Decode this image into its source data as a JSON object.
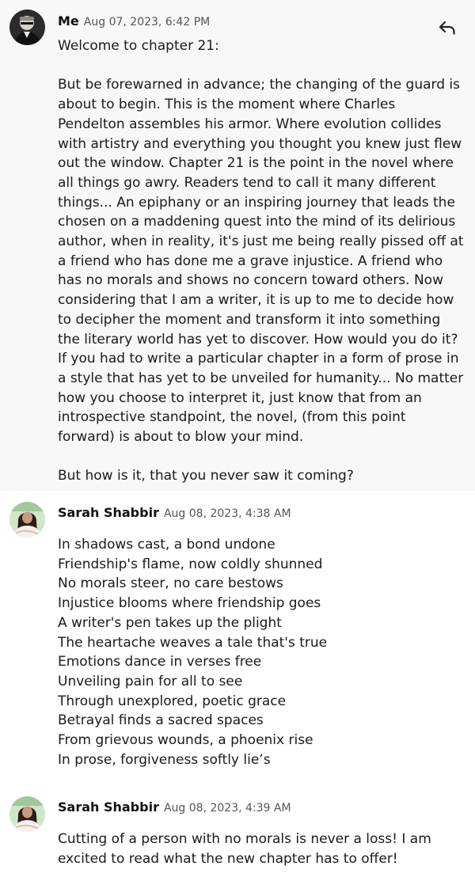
{
  "comments": [
    {
      "author": "Me",
      "timestamp": "Aug 07, 2023, 6:42 PM",
      "reply_icon": "reply-icon",
      "paragraphs": [
        "Welcome to chapter 21:",
        "But be forewarned in advance; the changing of the guard is about to begin. This is the moment where Charles Pendelton assembles his armor. Where evolution collides with artistry and everything you thought you knew just flew out the window. Chapter 21 is the point in the novel where all things go awry. Readers tend to call it many different things... An epiphany or an inspiring journey that leads the chosen on a maddening quest into the mind of its delirious author, when in reality, it's just me being really pissed off at a friend who has done me a grave injustice. A friend who has no morals and shows no concern toward others. Now considering that I am a writer, it is up to me to decide how to decipher the moment and transform it into something the literary world has yet to discover. How would you do it? If you had to write a particular chapter in a form of prose in a style that has yet to be unveiled for humanity... No matter how you choose to interpret it, just know that from an introspective standpoint, the novel, (from this point forward) is about to blow your mind.",
        "But how is it, that you never saw it coming?"
      ]
    },
    {
      "author": "Sarah Shabbir",
      "timestamp": "Aug 08, 2023, 4:38 AM",
      "lines": [
        "In shadows cast, a bond undone",
        "Friendship's flame, now coldly shunned",
        "No morals steer, no care bestows",
        "Injustice blooms where friendship goes",
        "A writer's pen takes up the plight",
        "The heartache weaves a tale that's true",
        "Emotions dance in verses free",
        "Unveiling pain for all to see",
        "Through unexplored, poetic grace",
        "Betrayal finds a sacred spaces",
        "From grievous wounds, a phoenix rise",
        "In prose, forgiveness softly lie’s"
      ]
    },
    {
      "author": "Sarah Shabbir",
      "timestamp": "Aug 08, 2023, 4:39 AM",
      "paragraphs": [
        "Cutting of a person with no morals is never a loss! I am excited to read what the new chapter has to offer!"
      ]
    }
  ]
}
